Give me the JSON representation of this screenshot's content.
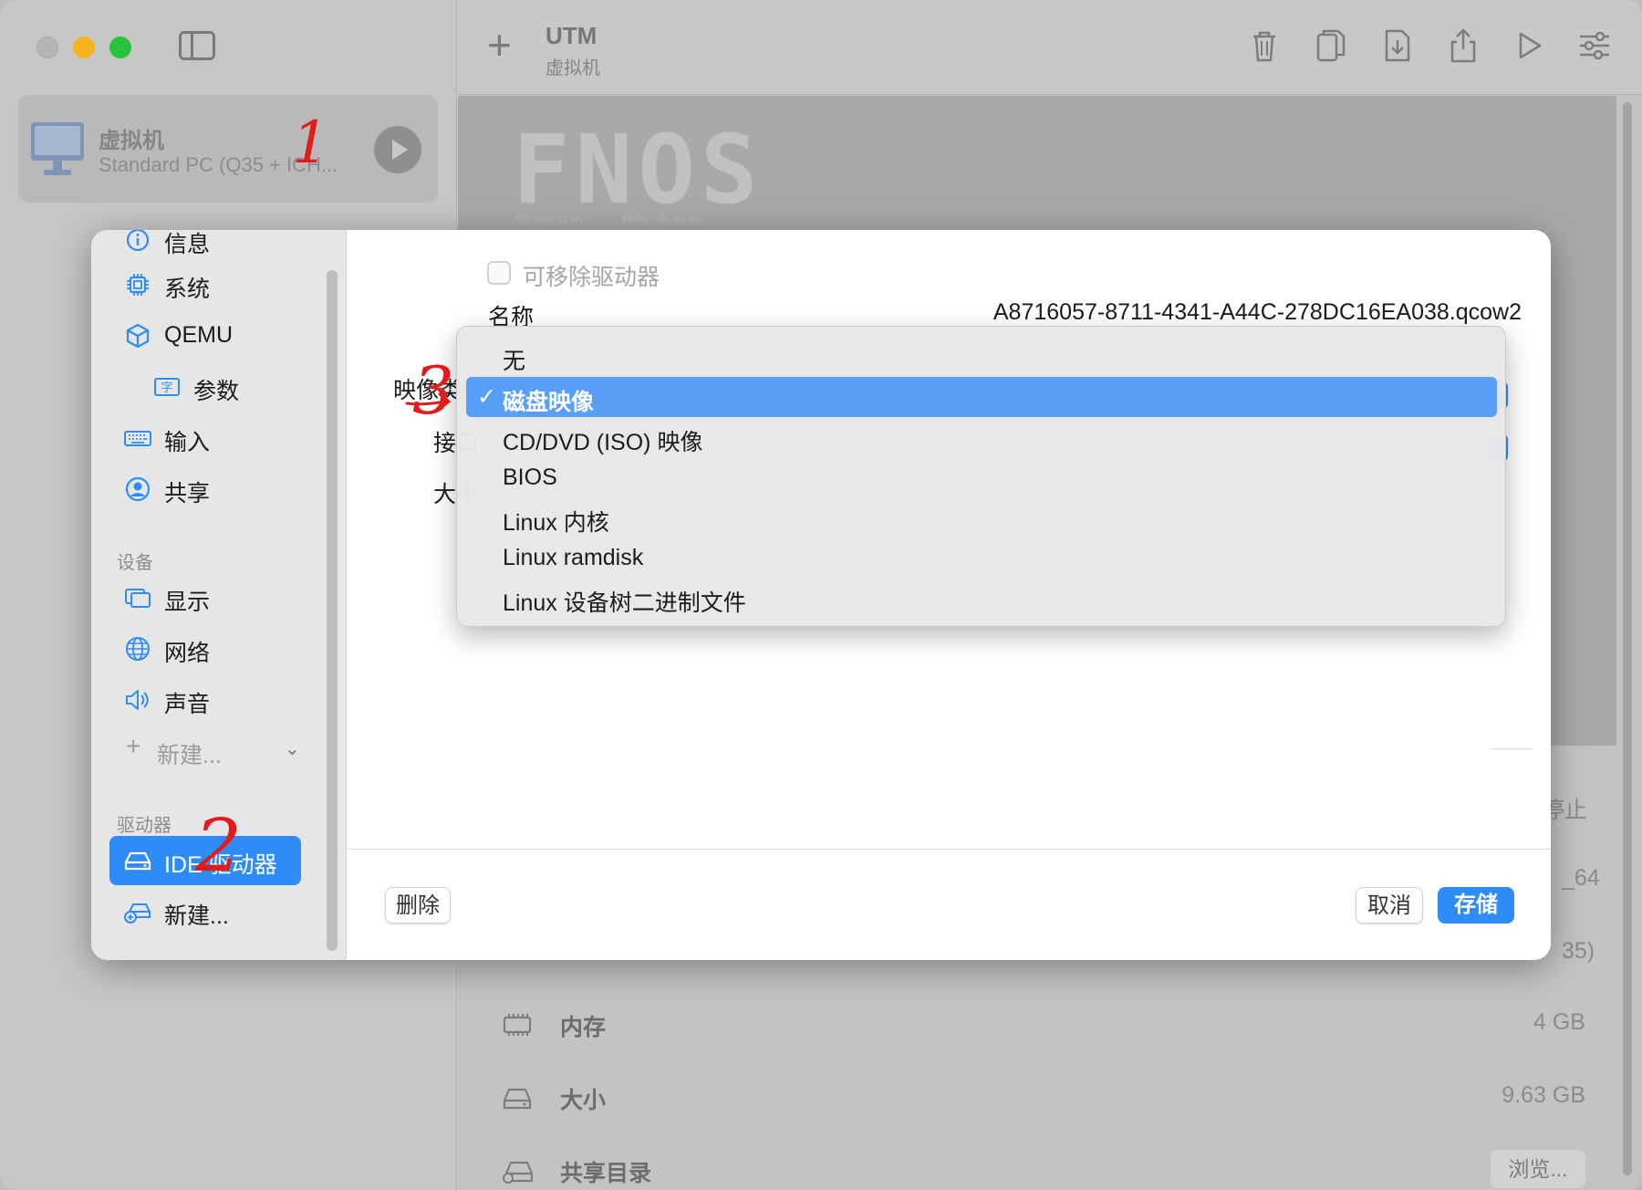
{
  "app": {
    "title": "UTM",
    "subtitle": "虚拟机"
  },
  "vm_list": [
    {
      "name": "虚拟机",
      "description": "Standard PC (Q35 + ICH..."
    }
  ],
  "preview": {
    "logo_text": "FNOS",
    "small_text": "OS version:     FNOS v0.x.xx"
  },
  "info_rows": [
    {
      "label": "内存",
      "value": "4 GB"
    },
    {
      "label": "大小",
      "value": "9.63 GB"
    },
    {
      "label": "共享目录",
      "button": "浏览..."
    }
  ],
  "partial_texts": [
    "停止",
    "_64",
    "35)"
  ],
  "sheet": {
    "sidebar": {
      "items": [
        {
          "label": "信息",
          "icon": "info-icon"
        },
        {
          "label": "系统",
          "icon": "cpu-icon"
        },
        {
          "label": "QEMU",
          "icon": "cube-icon"
        },
        {
          "label": "参数",
          "icon": "text-cursor-icon"
        },
        {
          "label": "输入",
          "icon": "keyboard-icon"
        },
        {
          "label": "共享",
          "icon": "person-icon"
        }
      ],
      "devices_header": "设备",
      "devices": [
        {
          "label": "显示",
          "icon": "display-icon"
        },
        {
          "label": "网络",
          "icon": "globe-icon"
        },
        {
          "label": "声音",
          "icon": "speaker-icon"
        }
      ],
      "new_device": "新建...",
      "drives_header": "驱动器",
      "drives": [
        {
          "label": "IDE 驱动器",
          "icon": "drive-icon",
          "selected": true
        }
      ],
      "new_drive": "新建..."
    },
    "form": {
      "removable_label": "可移除驱动器",
      "removable_checked": false,
      "name_label": "名称",
      "name_value": "A8716057-8711-4341-A44C-278DC16EA038.qcow2",
      "image_type_label": "映像类型",
      "interface_label": "接口",
      "size_label": "大小"
    },
    "buttons": {
      "delete": "删除",
      "cancel": "取消",
      "save": "存储"
    }
  },
  "image_type_menu": {
    "options": [
      "无",
      "磁盘映像",
      "CD/DVD (ISO) 映像",
      "BIOS",
      "Linux 内核",
      "Linux ramdisk",
      "Linux 设备树二进制文件"
    ],
    "selected": "磁盘映像",
    "checkmark": "✓"
  },
  "annotations": [
    "1",
    "2",
    "3"
  ],
  "colors": {
    "accent": "#2f8cf6",
    "menu_highlight": "#58a0f7",
    "annotation": "#e21b1b"
  }
}
